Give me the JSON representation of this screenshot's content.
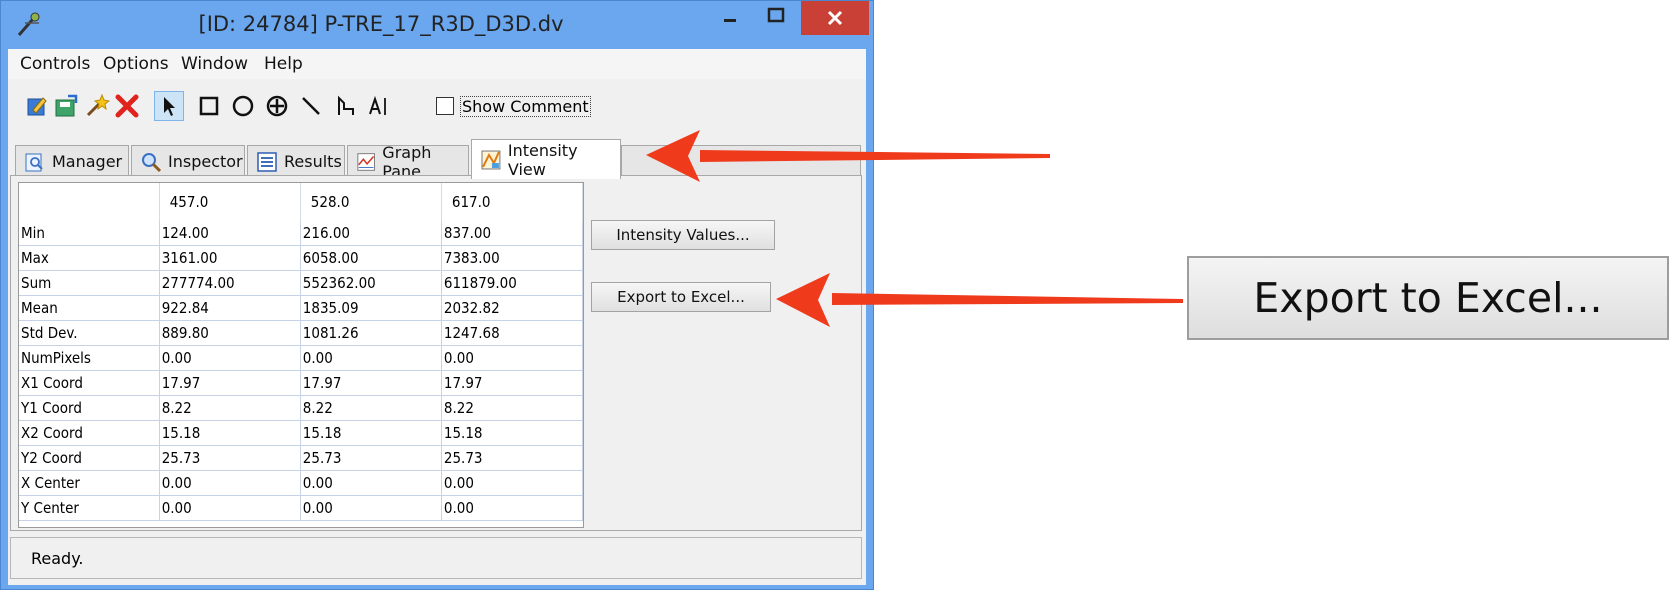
{
  "window": {
    "title": "[ID: 24784] P-TRE_17_R3D_D3D.dv"
  },
  "menu": [
    "Controls",
    "Options",
    "Window",
    "Help"
  ],
  "toolbar": {
    "show_comment_label": "Show Comment",
    "show_comment_checked": false
  },
  "tabs": [
    {
      "label": "Manager",
      "icon": "magnifier-doc-icon"
    },
    {
      "label": "Inspector",
      "icon": "magnifier-icon"
    },
    {
      "label": "Results",
      "icon": "list-icon"
    },
    {
      "label": "Graph Pane",
      "icon": "graph-icon"
    },
    {
      "label": "Intensity View",
      "icon": "intensity-icon",
      "active": true
    }
  ],
  "table": {
    "columns": [
      "",
      "457.0",
      "528.0",
      "617.0"
    ],
    "rows": [
      [
        "Min",
        "124.00",
        "216.00",
        "837.00"
      ],
      [
        "Max",
        "3161.00",
        "6058.00",
        "7383.00"
      ],
      [
        "Sum",
        "277774.00",
        "552362.00",
        "611879.00"
      ],
      [
        "Mean",
        "922.84",
        "1835.09",
        "2032.82"
      ],
      [
        "Std Dev.",
        "889.80",
        "1081.26",
        "1247.68"
      ],
      [
        "NumPixels",
        "0.00",
        "0.00",
        "0.00"
      ],
      [
        "X1 Coord",
        "17.97",
        "17.97",
        "17.97"
      ],
      [
        "Y1 Coord",
        "8.22",
        "8.22",
        "8.22"
      ],
      [
        "X2 Coord",
        "15.18",
        "15.18",
        "15.18"
      ],
      [
        "Y2 Coord",
        "25.73",
        "25.73",
        "25.73"
      ],
      [
        "X Center",
        "0.00",
        "0.00",
        "0.00"
      ],
      [
        "Y Center",
        "0.00",
        "0.00",
        "0.00"
      ]
    ]
  },
  "buttons": {
    "intensity_values": "Intensity Values...",
    "export_excel": "Export to Excel..."
  },
  "status": {
    "text": "Ready."
  },
  "callout": {
    "zoom_label": "Export to Excel..."
  },
  "colors": {
    "titlebar": "#6aa7ef",
    "close": "#c94136",
    "arrow": "#f03a1c"
  }
}
